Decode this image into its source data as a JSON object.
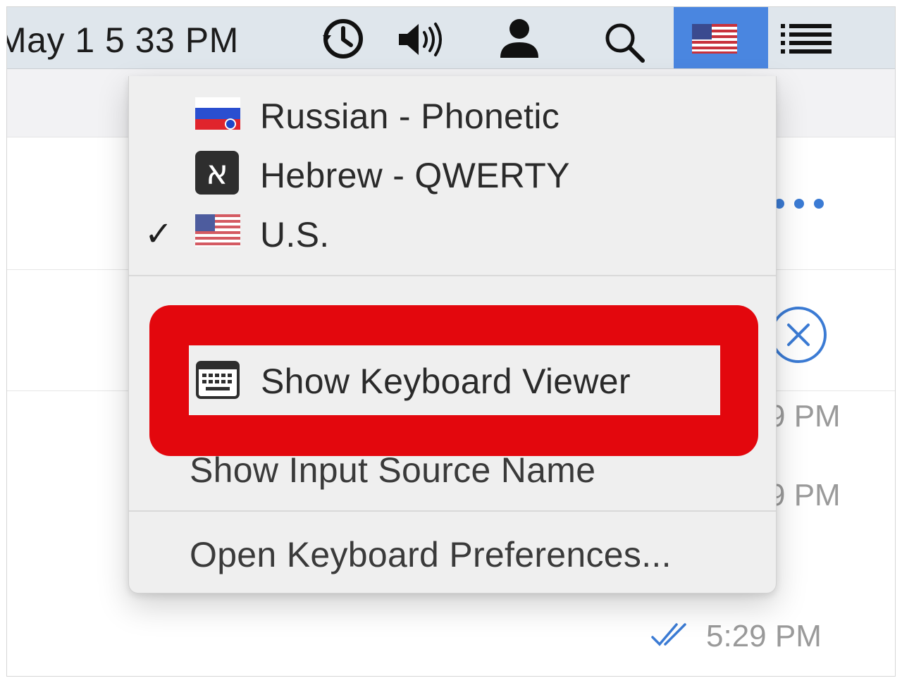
{
  "menubar": {
    "clock": "May 1  5 33 PM",
    "icons": [
      "time-machine-icon",
      "volume-icon",
      "user-icon",
      "search-icon",
      "us-flag-icon",
      "list-icon"
    ],
    "active_color": "#4a86e0"
  },
  "background": {
    "times": [
      "9 PM",
      "9 PM",
      "5:29 PM"
    ]
  },
  "input_menu": {
    "sources": [
      {
        "label": "Russian - Phonetic",
        "icon": "russian-flag-icon",
        "checked": false
      },
      {
        "label": "Hebrew - QWERTY",
        "icon": "hebrew-layout-icon",
        "checked": false
      },
      {
        "label": "U.S.",
        "icon": "us-flag-icon",
        "checked": true
      }
    ],
    "check_mark": "✓",
    "hebrew_glyph": "א",
    "show_keyboard_viewer": "Show Keyboard Viewer",
    "show_input_source_name": "Show Input Source Name",
    "open_keyboard_preferences": "Open Keyboard Preferences..."
  },
  "highlight_color": "#e3070d"
}
